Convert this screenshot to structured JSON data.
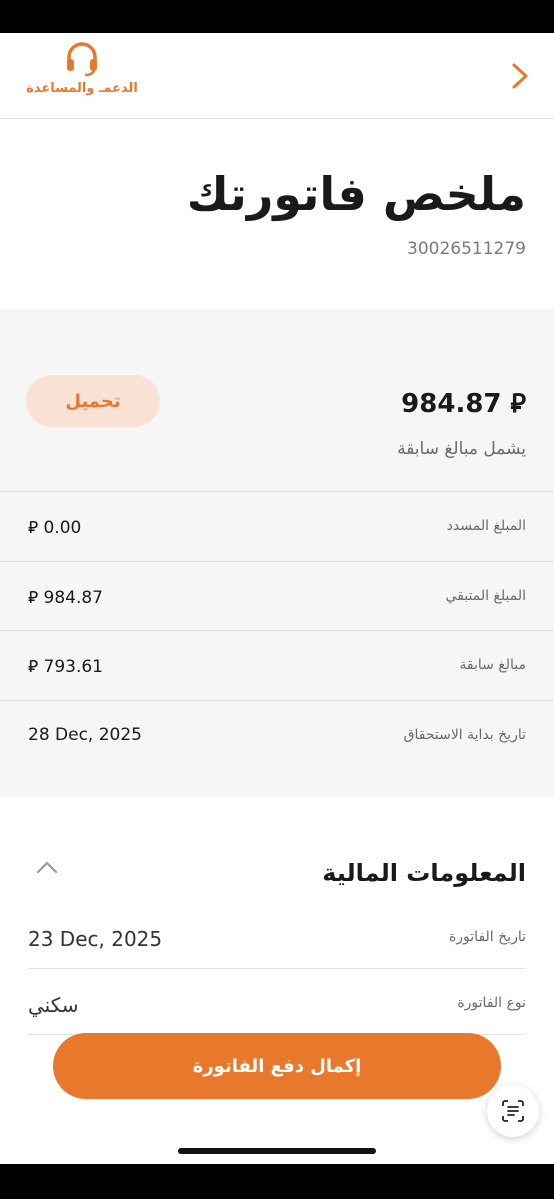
{
  "header": {
    "support_label": "الدعمـ والمساعدة"
  },
  "title": {
    "text": "ملخص فاتورتك",
    "invoice_number": "30026511279"
  },
  "summary": {
    "total_amount": "984.87 ⃁",
    "includes_note": "يشمل مبالغ سابقة",
    "download_label": "تحميل",
    "rows": [
      {
        "label": "المبلغ المسدد",
        "value": "⃁ 0.00"
      },
      {
        "label": "المبلغ المتبقي",
        "value": "⃁ 984.87"
      },
      {
        "label": "مبالغ سابقة",
        "value": "⃁ 793.61"
      },
      {
        "label": "تاريخ بداية الاستحقاق",
        "value": "28 Dec, 2025"
      }
    ]
  },
  "financial_info": {
    "title": "المعلومات المالية",
    "rows": [
      {
        "label": "تاريخ الفاتورة",
        "value": "23 Dec, 2025"
      },
      {
        "label": "نوع الفاتورة",
        "value": "سكني"
      }
    ]
  },
  "actions": {
    "pay_label": "إكمال دفع الفاتورة"
  },
  "colors": {
    "accent": "#e8792c",
    "accent_light": "#f9e2d3",
    "summary_bg": "#f6f6f6"
  },
  "icons": {
    "support": "headset-icon",
    "back": "chevron-right-icon",
    "collapse": "chevron-up-icon",
    "scan": "scan-text-icon"
  }
}
